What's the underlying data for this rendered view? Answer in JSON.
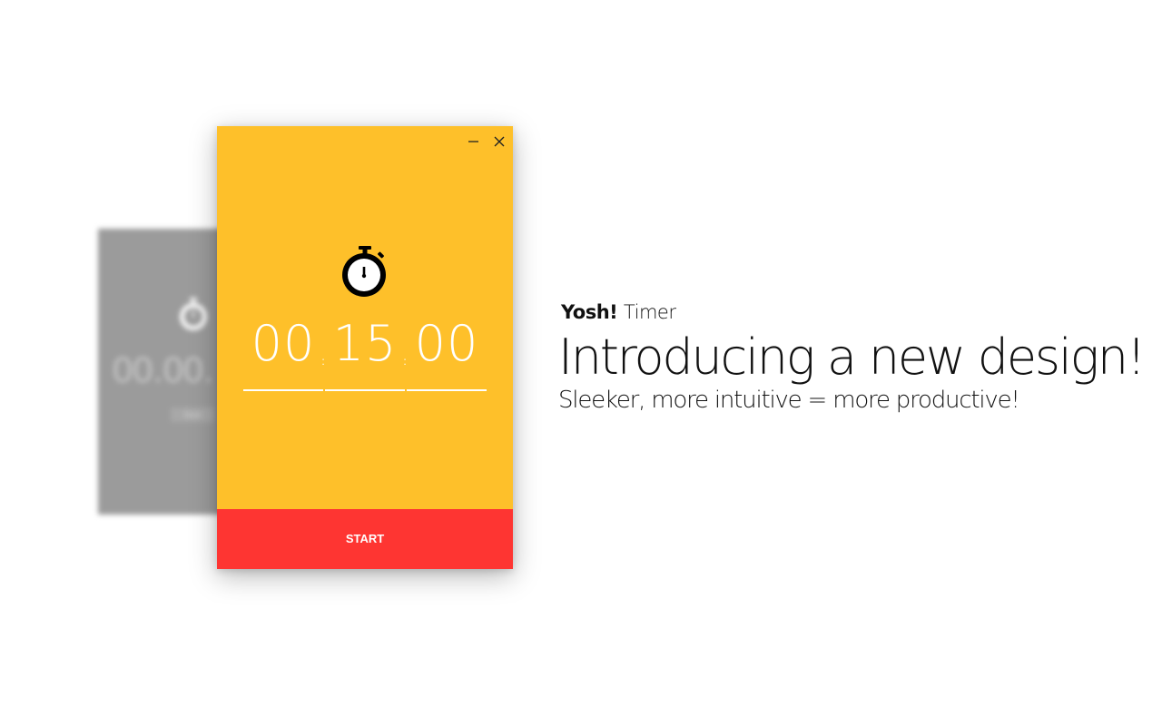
{
  "old_window": {
    "time": "00.00.",
    "button_label": "Start"
  },
  "timer_window": {
    "minimize_icon": "minimize-icon",
    "close_icon": "close-icon",
    "stopwatch_icon": "stopwatch-icon",
    "hours": "00",
    "minutes": "15",
    "seconds": "00",
    "separator": ":",
    "start_label": "START",
    "colors": {
      "background": "#fec02a",
      "start_button": "#fe3532",
      "digits": "#ffffff"
    }
  },
  "promo": {
    "brand_bold": "Yosh!",
    "brand_light": "Timer",
    "headline": "Introducing a new design!",
    "subline": "Sleeker, more intuitive = more productive!"
  }
}
